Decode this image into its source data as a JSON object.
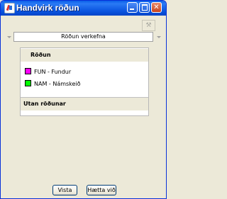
{
  "window": {
    "title": "Handvirk röðun",
    "caption_buttons": [
      "minimize",
      "maximize",
      "close"
    ]
  },
  "toolbar": {
    "tool_icon": "wrench-icon"
  },
  "selector": {
    "value": "Röðun verkefna"
  },
  "sections": [
    {
      "title": "Röðun",
      "items": [
        {
          "label": "FUN - Fundur",
          "color": "#ff00ff"
        },
        {
          "label": "NAM - Námskeið",
          "color": "#00ff00"
        }
      ]
    },
    {
      "title": "Utan röðunar",
      "items": []
    }
  ],
  "buttons": {
    "save": "Vista",
    "cancel": "Hætta við"
  }
}
